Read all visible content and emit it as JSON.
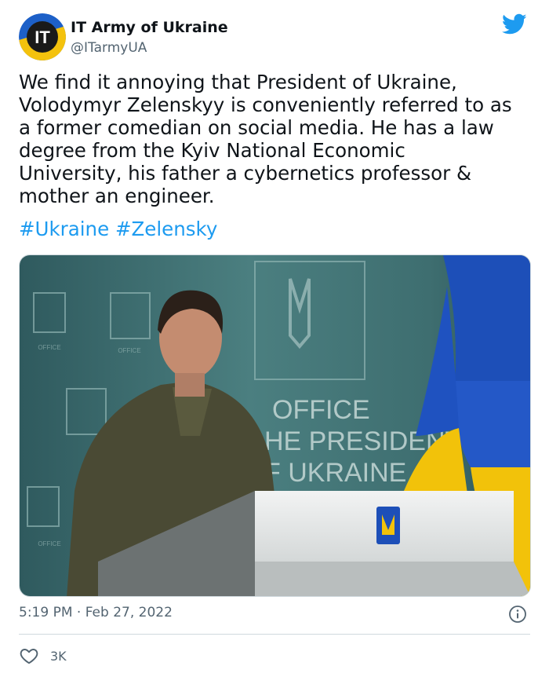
{
  "account": {
    "display_name": "IT Army of Ukraine",
    "handle": "@ITarmyUA",
    "avatar_text": "IT"
  },
  "tweet": {
    "text_lines": [
      "We find it annoying that President of Ukraine,",
      "Volodymyr Zelenskyy is conveniently referred to as",
      "a former comedian on social media. He has a law",
      "degree from the Kyiv National Economic",
      "University, his father a cybernetics professor &",
      "mother an engineer."
    ],
    "hashtags": [
      "#Ukraine",
      "#Zelensky"
    ],
    "timestamp": "5:19 PM · Feb 27, 2022",
    "like_count": "3K"
  },
  "media": {
    "sign_lines": [
      "OFFICE",
      "HE PRESIDENT",
      "F UKRAINE"
    ]
  },
  "colors": {
    "link": "#1d9bf0",
    "twitter_blue": "#1d9bf0",
    "secondary_text": "#536471",
    "flag_blue": "#1d4fb8",
    "flag_yellow": "#f2c20a"
  },
  "icons": {
    "brand": "twitter-bird-icon",
    "info": "info-icon",
    "like": "heart-icon"
  }
}
